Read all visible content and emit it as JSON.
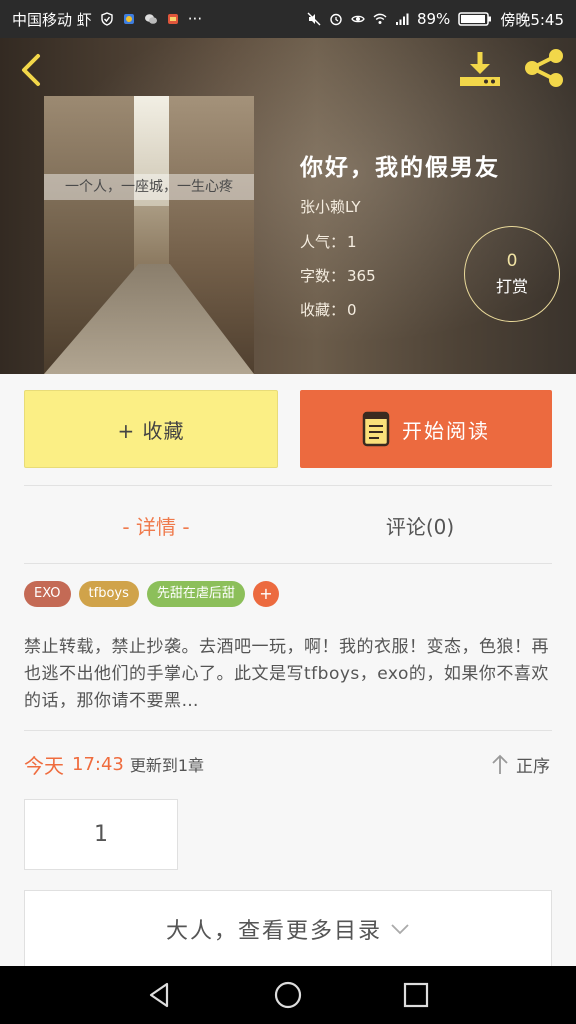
{
  "status_bar": {
    "carrier": "中国移动 虾",
    "notif_more": "···",
    "battery": "89%",
    "time": "傍晚5:45"
  },
  "book": {
    "title": "你好，我的假男友",
    "author": "张小赖LY",
    "popularity_label": "人气：",
    "popularity": "1",
    "word_count_label": "字数：",
    "word_count": "365",
    "favorites_label": "收藏：",
    "favorites": "0",
    "cover_caption": "一个人，一座城，一生心疼"
  },
  "tip": {
    "count": "0",
    "label": "打赏"
  },
  "actions": {
    "favorite_label": "+ 收藏",
    "read_label": "开始阅读"
  },
  "tabs": {
    "details": "- 详情 -",
    "comments": "评论(0)"
  },
  "tags": [
    {
      "label": "EXO",
      "color": "#c46a55"
    },
    {
      "label": "tfboys",
      "color": "#d0a34a"
    },
    {
      "label": "先甜在虐后甜",
      "color": "#8cbf5a"
    }
  ],
  "tag_add": "+",
  "description": "禁止转载，禁止抄袭。去酒吧一玩，啊！我的衣服！变态，色狼！再也逃不出他们的手掌心了。此文是写tfboys，exo的，如果你不喜欢的话，那你请不要黑…",
  "update": {
    "day": "今天",
    "time": "17:43",
    "text": "更新到1章"
  },
  "sort_label": "正序",
  "chapter_number": "1",
  "more_toc_label": "大人，查看更多目录",
  "colors": {
    "accent_orange": "#ec6a3f",
    "favorite_yellow": "#fbef85"
  }
}
